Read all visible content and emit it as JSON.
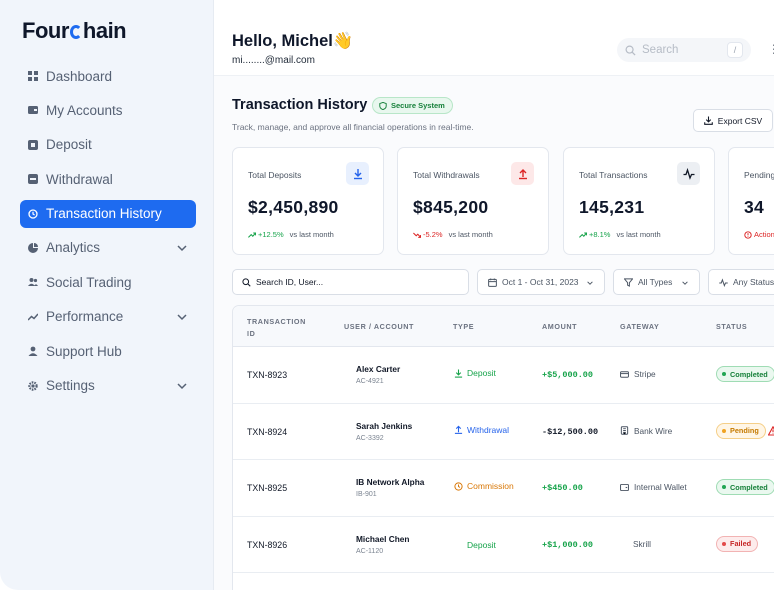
{
  "app": {
    "logo_left": "Four",
    "logo_right": "hain"
  },
  "sidebar": {
    "items": [
      {
        "label": "Dashboard",
        "icon": "grid-icon"
      },
      {
        "label": "My Accounts",
        "icon": "wallet-icon"
      },
      {
        "label": "Deposit",
        "icon": "deposit-icon"
      },
      {
        "label": "Withdrawal",
        "icon": "withdrawal-icon"
      },
      {
        "label": "Transaction History",
        "icon": "history-icon",
        "active": true
      },
      {
        "label": "Analytics",
        "icon": "pie-chart-icon"
      },
      {
        "label": "Social Trading",
        "icon": "users-icon"
      },
      {
        "label": "Performance",
        "icon": "trend-icon"
      },
      {
        "label": "Support Hub",
        "icon": "user-icon"
      },
      {
        "label": "Settings",
        "icon": "gear-icon"
      }
    ]
  },
  "header": {
    "greeting": "Hello, Michel👋",
    "email": "mi........@mail.com",
    "search_placeholder": "Search",
    "search_shortcut": "/",
    "more": "⋮"
  },
  "page": {
    "title": "Transaction History",
    "badge": "Secure System",
    "subtitle": "Track, manage, and approve all financial operations in real-time.",
    "export_label": "Export CSV"
  },
  "cards": [
    {
      "label": "Total Deposits",
      "value": "$2,450,890",
      "trend": "+12.5%",
      "trend_label": "vs last month",
      "trend_color": "#16a34a",
      "icon_bg": "#e8f0fe",
      "icon_color": "#2563eb"
    },
    {
      "label": "Total Withdrawals",
      "value": "$845,200",
      "trend": "-5.2%",
      "trend_label": "vs last month",
      "trend_color": "#dc2626",
      "icon_bg": "#fde8e8",
      "icon_color": "#dc2626"
    },
    {
      "label": "Total Transactions",
      "value": "145,231",
      "trend": "+8.1%",
      "trend_label": "vs last month",
      "trend_color": "#16a34a",
      "icon_bg": "#eceff3",
      "icon_color": "#111827"
    },
    {
      "label": "Pending",
      "value": "34",
      "trend": "Action",
      "trend_label": "",
      "trend_color": "#dc2626",
      "icon_bg": "#fff4e0",
      "icon_color": "#d97706"
    }
  ],
  "filters": {
    "search_placeholder": "Search ID, User...",
    "date_range": "Oct 1 - Oct 31, 2023",
    "type": "All Types",
    "status": "Any Status"
  },
  "table": {
    "headers": {
      "txn_a": "TRANSACTION",
      "txn_b": "ID",
      "user": "USER / ACCOUNT",
      "type": "TYPE",
      "amount": "AMOUNT",
      "gateway": "GATEWAY",
      "status": "STATUS"
    },
    "rows": [
      {
        "id": "TXN-8923",
        "user": "Alex Carter",
        "account": "AC-4921",
        "type": "Deposit",
        "amount": "+$5,000.00",
        "gateway": "Stripe",
        "status": "Completed"
      },
      {
        "id": "TXN-8924",
        "user": "Sarah Jenkins",
        "account": "AC-3392",
        "type": "Withdrawal",
        "amount": "-$12,500.00",
        "gateway": "Bank Wire",
        "status": "Pending"
      },
      {
        "id": "TXN-8925",
        "user": "IB Network Alpha",
        "account": "IB-901",
        "type": "Commission",
        "amount": "+$450.00",
        "gateway": "Internal Wallet",
        "status": "Completed"
      },
      {
        "id": "TXN-8926",
        "user": "Michael Chen",
        "account": "AC-1120",
        "type": "Deposit",
        "amount": "+$1,000.00",
        "gateway": "Skrill",
        "status": "Failed"
      }
    ]
  },
  "colors": {
    "accent": "#1e6bf0",
    "positive": "#16a34a",
    "negative": "#dc2626",
    "warning": "#d97706"
  }
}
